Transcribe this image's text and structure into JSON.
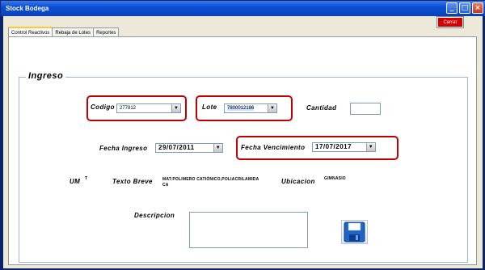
{
  "window": {
    "title": "Stock Bodega"
  },
  "toolbar": {
    "close_label": "Cerrar"
  },
  "tabs": [
    {
      "label": "Control Reactivos",
      "active": true
    },
    {
      "label": "Rebaja de Lotes",
      "active": false
    },
    {
      "label": "Reportes",
      "active": false
    }
  ],
  "form": {
    "group_title": "Ingreso",
    "codigo_label": "Codigo",
    "codigo_value": "277812",
    "lote_label": "Lote",
    "lote_value": "7800012186",
    "cantidad_label": "Cantidad",
    "cantidad_value": "",
    "fecha_ingreso_label": "Fecha Ingreso",
    "fecha_ingreso_value": "29/07/2011",
    "fecha_vencimiento_label": "Fecha Vencimiento",
    "fecha_vencimiento_value": "17/07/2017",
    "um_label": "UM",
    "um_value": "T",
    "texto_breve_label": "Texto Breve",
    "texto_breve_line1": "MAT:POLIMERO CATIÓNICO,POLIACRILAMIDA",
    "texto_breve_line2": "CA",
    "ubicacion_label": "Ubicacion",
    "ubicacion_value": "GIMNASIO",
    "descripcion_label": "Descripcion",
    "descripcion_value": ""
  },
  "icons": {
    "save": "floppy-disk-icon",
    "dropdown": "chevron-down-icon",
    "minimize": "minimize-icon",
    "maximize": "maximize-icon",
    "close": "close-icon"
  },
  "colors": {
    "highlight": "#c00000",
    "close_button": "#d40000",
    "titlebar": "#0a4ed6"
  }
}
